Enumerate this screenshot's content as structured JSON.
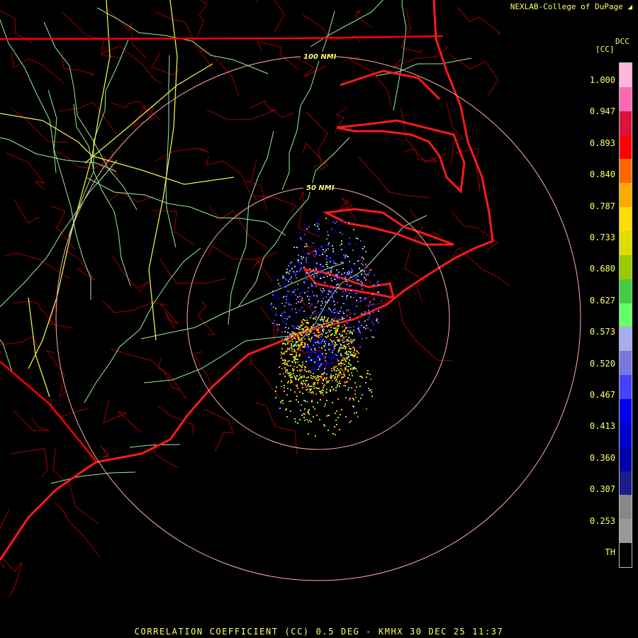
{
  "header": {
    "credit": "NEXLAB-College of DuPage",
    "credit_icon": "logo-mark-icon"
  },
  "legend": {
    "product_code": "DCC",
    "unit_label": "[CC]",
    "labels": [
      "1.000",
      "0.947",
      "0.893",
      "0.840",
      "0.787",
      "0.733",
      "0.680",
      "0.627",
      "0.573",
      "0.520",
      "0.467",
      "0.413",
      "0.360",
      "0.307",
      "0.253",
      "TH"
    ],
    "colors": [
      "#ffb6d9",
      "#ff69b4",
      "#dc143c",
      "#ff0000",
      "#ff6600",
      "#ffaa00",
      "#ffdd00",
      "#dddd00",
      "#99cc00",
      "#44cc44",
      "#66ff66",
      "#aaaaee",
      "#7777dd",
      "#4444ff",
      "#0000ee",
      "#0000cc",
      "#0000aa",
      "#1c1c8a",
      "#888888",
      "#999999",
      "#000000"
    ]
  },
  "map": {
    "range_rings": [
      "100 NMI",
      "50 NMI"
    ],
    "colors": {
      "state_border": "#ff0000",
      "county_border": "#c00000",
      "highway": "#99ee99",
      "interstate": "#eeee44",
      "range_ring": "#ffb0a0"
    }
  },
  "footer": {
    "caption": "CORRELATION COEFFICIENT (CC) 0.5 DEG - KMHX 30 DEC 25 11:37"
  }
}
